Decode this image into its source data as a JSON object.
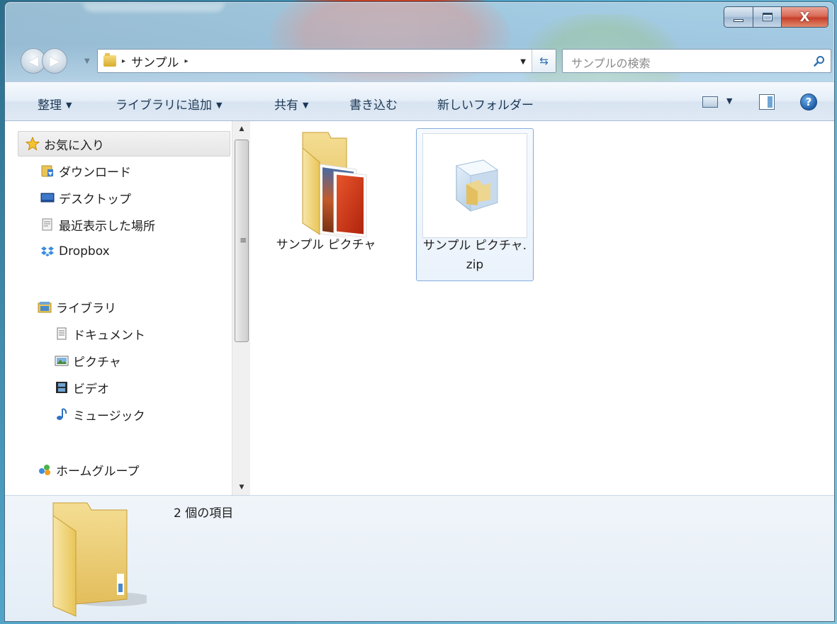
{
  "window": {
    "caption_buttons": {
      "minimize": "–",
      "maximize": "□",
      "close": "X"
    }
  },
  "nav": {
    "back_glyph": "◀",
    "forward_glyph": "▶",
    "breadcrumb": {
      "separator": "▸",
      "location": "サンプル"
    },
    "search_placeholder": "サンプルの検索"
  },
  "toolbar": {
    "organize": "整理",
    "add_to_library": "ライブラリに追加",
    "share": "共有",
    "burn": "書き込む",
    "new_folder": "新しいフォルダー",
    "help_glyph": "?"
  },
  "sidebar": {
    "favorites": {
      "label": "お気に入り"
    },
    "favorites_items": [
      {
        "label": "ダウンロード",
        "icon": "downloads-icon"
      },
      {
        "label": "デスクトップ",
        "icon": "desktop-icon"
      },
      {
        "label": "最近表示した場所",
        "icon": "recent-places-icon"
      },
      {
        "label": "Dropbox",
        "icon": "dropbox-icon"
      }
    ],
    "libraries": {
      "label": "ライブラリ"
    },
    "library_items": [
      {
        "label": "ドキュメント",
        "icon": "documents-icon"
      },
      {
        "label": "ピクチャ",
        "icon": "pictures-icon"
      },
      {
        "label": "ビデオ",
        "icon": "videos-icon"
      },
      {
        "label": "ミュージック",
        "icon": "music-icon"
      }
    ],
    "homegroup": {
      "label": "ホームグループ"
    }
  },
  "files": [
    {
      "name": "サンプル ピクチャ",
      "type": "folder",
      "selected": false
    },
    {
      "name": "サンプル ピクチャ.zip",
      "type": "zip",
      "selected": true
    }
  ],
  "details": {
    "item_count": "2 個の項目"
  },
  "colors": {
    "accent": "#2c6fb0",
    "selection_border": "#84acdd",
    "folder_yellow": "#e8c558"
  }
}
